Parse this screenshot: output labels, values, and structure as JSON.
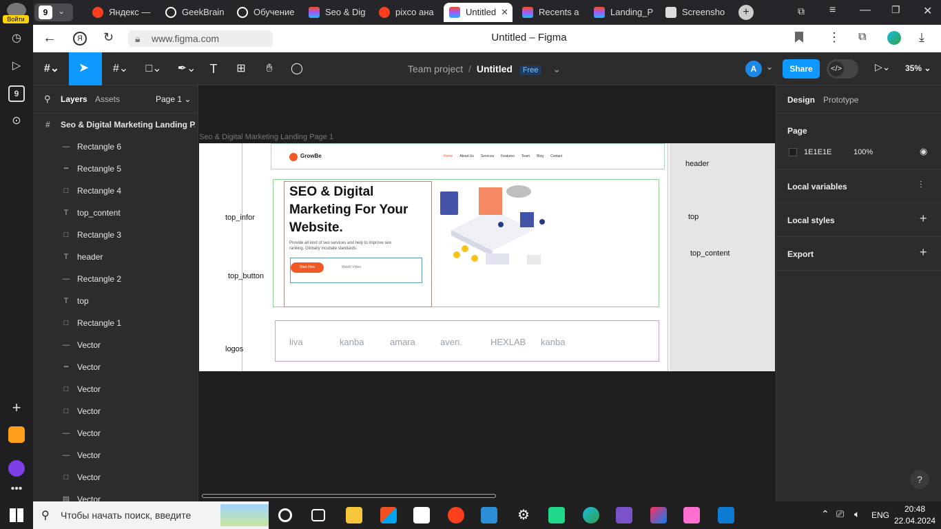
{
  "rail": {
    "login_label": "Войти",
    "badge": "9",
    "badge2": "9"
  },
  "tabs": [
    {
      "label": "9",
      "icon_color": "#555"
    },
    {
      "label": "Яндекс —",
      "icon_color": "#fc3f1d"
    },
    {
      "label": "GeekBrain",
      "icon_color": "#fff"
    },
    {
      "label": "Обучение",
      "icon_color": "#fff"
    },
    {
      "label": "Seo & Dig",
      "icon_color": "#a259ff"
    },
    {
      "label": "pixco ана",
      "icon_color": "#fc3f1d"
    },
    {
      "label": "Untitled",
      "icon_color": "#a259ff"
    },
    {
      "label": "Recents a",
      "icon_color": "#a259ff"
    },
    {
      "label": "Landing_P",
      "icon_color": "#a259ff"
    },
    {
      "label": "Screensho",
      "icon_color": "#ddd"
    }
  ],
  "address": {
    "url": "www.figma.com",
    "title": "Untitled – Figma"
  },
  "toolbar": {
    "project": "Team project",
    "separator": "/",
    "file": "Untitled",
    "plan": "Free",
    "avatar": "A",
    "share": "Share",
    "zoom": "35%"
  },
  "left": {
    "tab_layers": "Layers",
    "tab_assets": "Assets",
    "page": "Page 1",
    "frame": "Seo & Digital Marketing Landing P...",
    "layers": [
      {
        "name": "Rectangle 6",
        "icon": "line-icon"
      },
      {
        "name": "Rectangle 5",
        "icon": "dash-icon"
      },
      {
        "name": "Rectangle 4",
        "icon": "rect-icon"
      },
      {
        "name": "top_content",
        "icon": "text-icon"
      },
      {
        "name": "Rectangle 3",
        "icon": "rect-icon"
      },
      {
        "name": "header",
        "icon": "text-icon"
      },
      {
        "name": "Rectangle 2",
        "icon": "line-icon"
      },
      {
        "name": "top",
        "icon": "text-icon"
      },
      {
        "name": "Rectangle 1",
        "icon": "rect-icon"
      },
      {
        "name": "Vector",
        "icon": "line-icon"
      },
      {
        "name": "Vector",
        "icon": "dash-icon"
      },
      {
        "name": "Vector",
        "icon": "rect-icon"
      },
      {
        "name": "Vector",
        "icon": "rect-icon"
      },
      {
        "name": "Vector",
        "icon": "line-icon"
      },
      {
        "name": "Vector",
        "icon": "line-icon"
      },
      {
        "name": "Vector",
        "icon": "rect-icon"
      },
      {
        "name": "Vector",
        "icon": "image-icon"
      }
    ]
  },
  "canvas": {
    "frame_label": "Seo & Digital Marketing Landing Page 1",
    "labels": {
      "top_infor": "top_infor",
      "top_button": "top_button",
      "logos": "logos",
      "header": "header",
      "top": "top",
      "top_content": "top_content"
    },
    "site": {
      "brand": "GrowBe",
      "nav": [
        "Home",
        "About Us",
        "Services",
        "Features",
        "Team",
        "Blog",
        "Contact"
      ],
      "hero_title": "SEO & Digital Marketing For Your Website.",
      "hero_text": "Provide all kind of seo services and help to improve seo ranking. Globally incubate standards.",
      "btn_primary": "Start Now",
      "btn_secondary": "Watch Video",
      "logos": [
        "liva",
        "kanba",
        "amara",
        "aven.",
        "HEXLAB",
        "kanba"
      ]
    }
  },
  "right": {
    "tab_design": "Design",
    "tab_prototype": "Prototype",
    "page_title": "Page",
    "color": "1E1E1E",
    "opacity": "100%",
    "local_variables": "Local variables",
    "local_styles": "Local styles",
    "export": "Export"
  },
  "taskbar": {
    "search": "Чтобы начать поиск, введите",
    "lang": "ENG",
    "time": "20:48",
    "date": "22.04.2024"
  }
}
